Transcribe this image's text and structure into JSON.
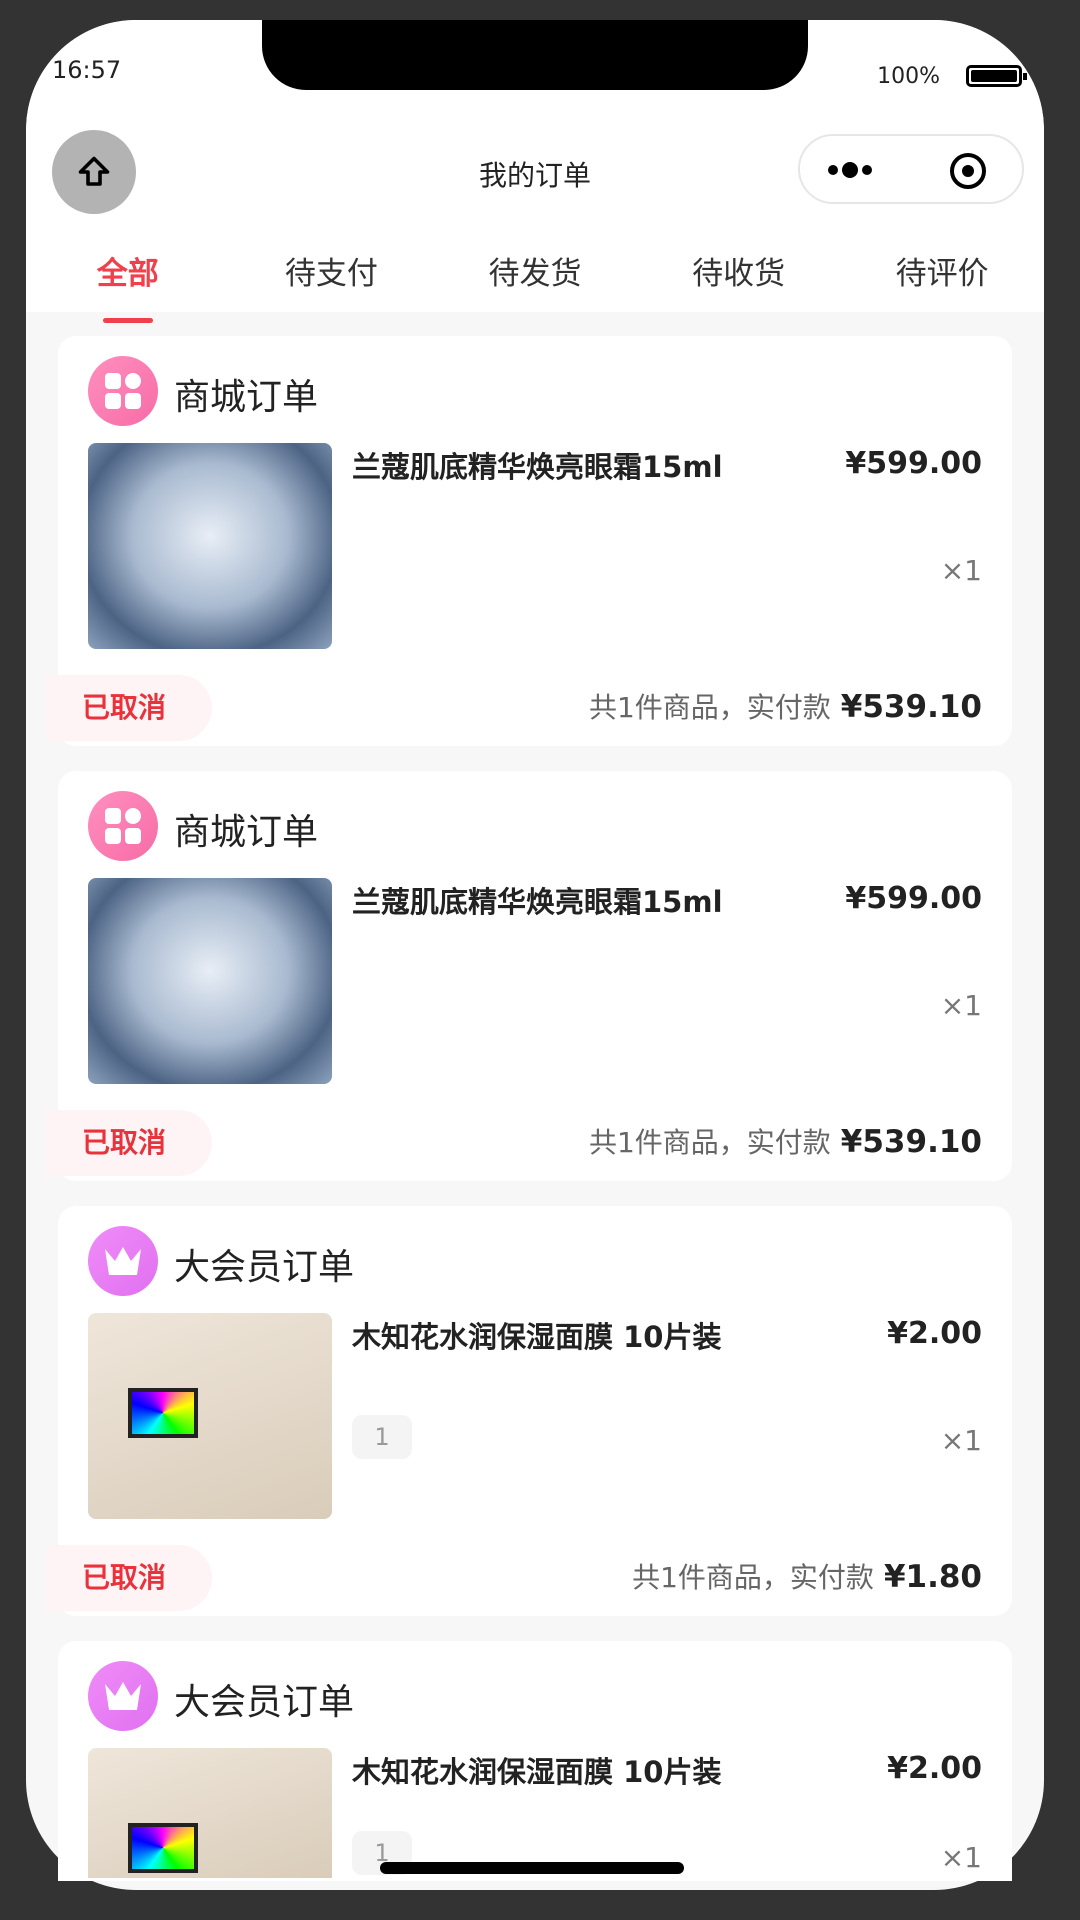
{
  "status_bar": {
    "time": "16:57",
    "battery": "100%"
  },
  "nav": {
    "title": "我的订单"
  },
  "tabs": [
    {
      "label": "全部",
      "active": true
    },
    {
      "label": "待支付"
    },
    {
      "label": "待发货"
    },
    {
      "label": "待收货"
    },
    {
      "label": "待评价"
    }
  ],
  "orders": [
    {
      "type": "商城订单",
      "icon": "mall-grid-icon",
      "product": "兰蔻肌底精华焕亮眼霜15ml",
      "price": "¥599.00",
      "qty": "×1",
      "status": "已取消",
      "summary": "共1件商品，实付款",
      "paid": "¥539.10"
    },
    {
      "type": "商城订单",
      "icon": "mall-grid-icon",
      "product": "兰蔻肌底精华焕亮眼霜15ml",
      "price": "¥599.00",
      "qty": "×1",
      "status": "已取消",
      "summary": "共1件商品，实付款",
      "paid": "¥539.10"
    },
    {
      "type": "大会员订单",
      "icon": "crown-icon",
      "product": "木知花水润保湿面膜 10片装",
      "price": "¥2.00",
      "spec": "1",
      "qty": "×1",
      "status": "已取消",
      "summary": "共1件商品，实付款",
      "paid": "¥1.80"
    },
    {
      "type": "大会员订单",
      "icon": "crown-icon",
      "product": "木知花水润保湿面膜 10片装",
      "price": "¥2.00",
      "spec": "1",
      "qty": "×1"
    }
  ],
  "colors": {
    "accent": "#f0404c",
    "mall_icon": "#f76ca6",
    "vip_icon": "#e070f0"
  }
}
